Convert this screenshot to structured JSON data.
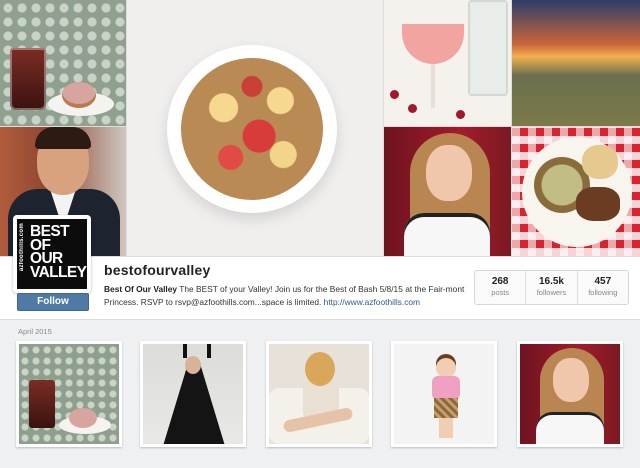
{
  "profile": {
    "username": "bestofourvalley",
    "avatar_logo_text": "BEST OF OUR VALLEY",
    "avatar_site_text": "azfoothills.com",
    "follow_label": "Follow",
    "bio_name": "Best Of Our Valley",
    "bio_text": " The BEST of your Valley! Join us for the Best of Bash 5/8/15 at the Fair-mont Princess. RSVP to rsvp@azfoothills.com...space is limited. ",
    "bio_link": "http://www.azfoothills.com"
  },
  "stats": [
    {
      "value": "268",
      "label": "posts"
    },
    {
      "value": "16.5k",
      "label": "followers"
    },
    {
      "value": "457",
      "label": "following"
    }
  ],
  "grid": {
    "month_label": "April 2015"
  },
  "colors": {
    "follow_button": "#4f7aa6",
    "link": "#2d5b93",
    "background": "#eff0f1"
  }
}
